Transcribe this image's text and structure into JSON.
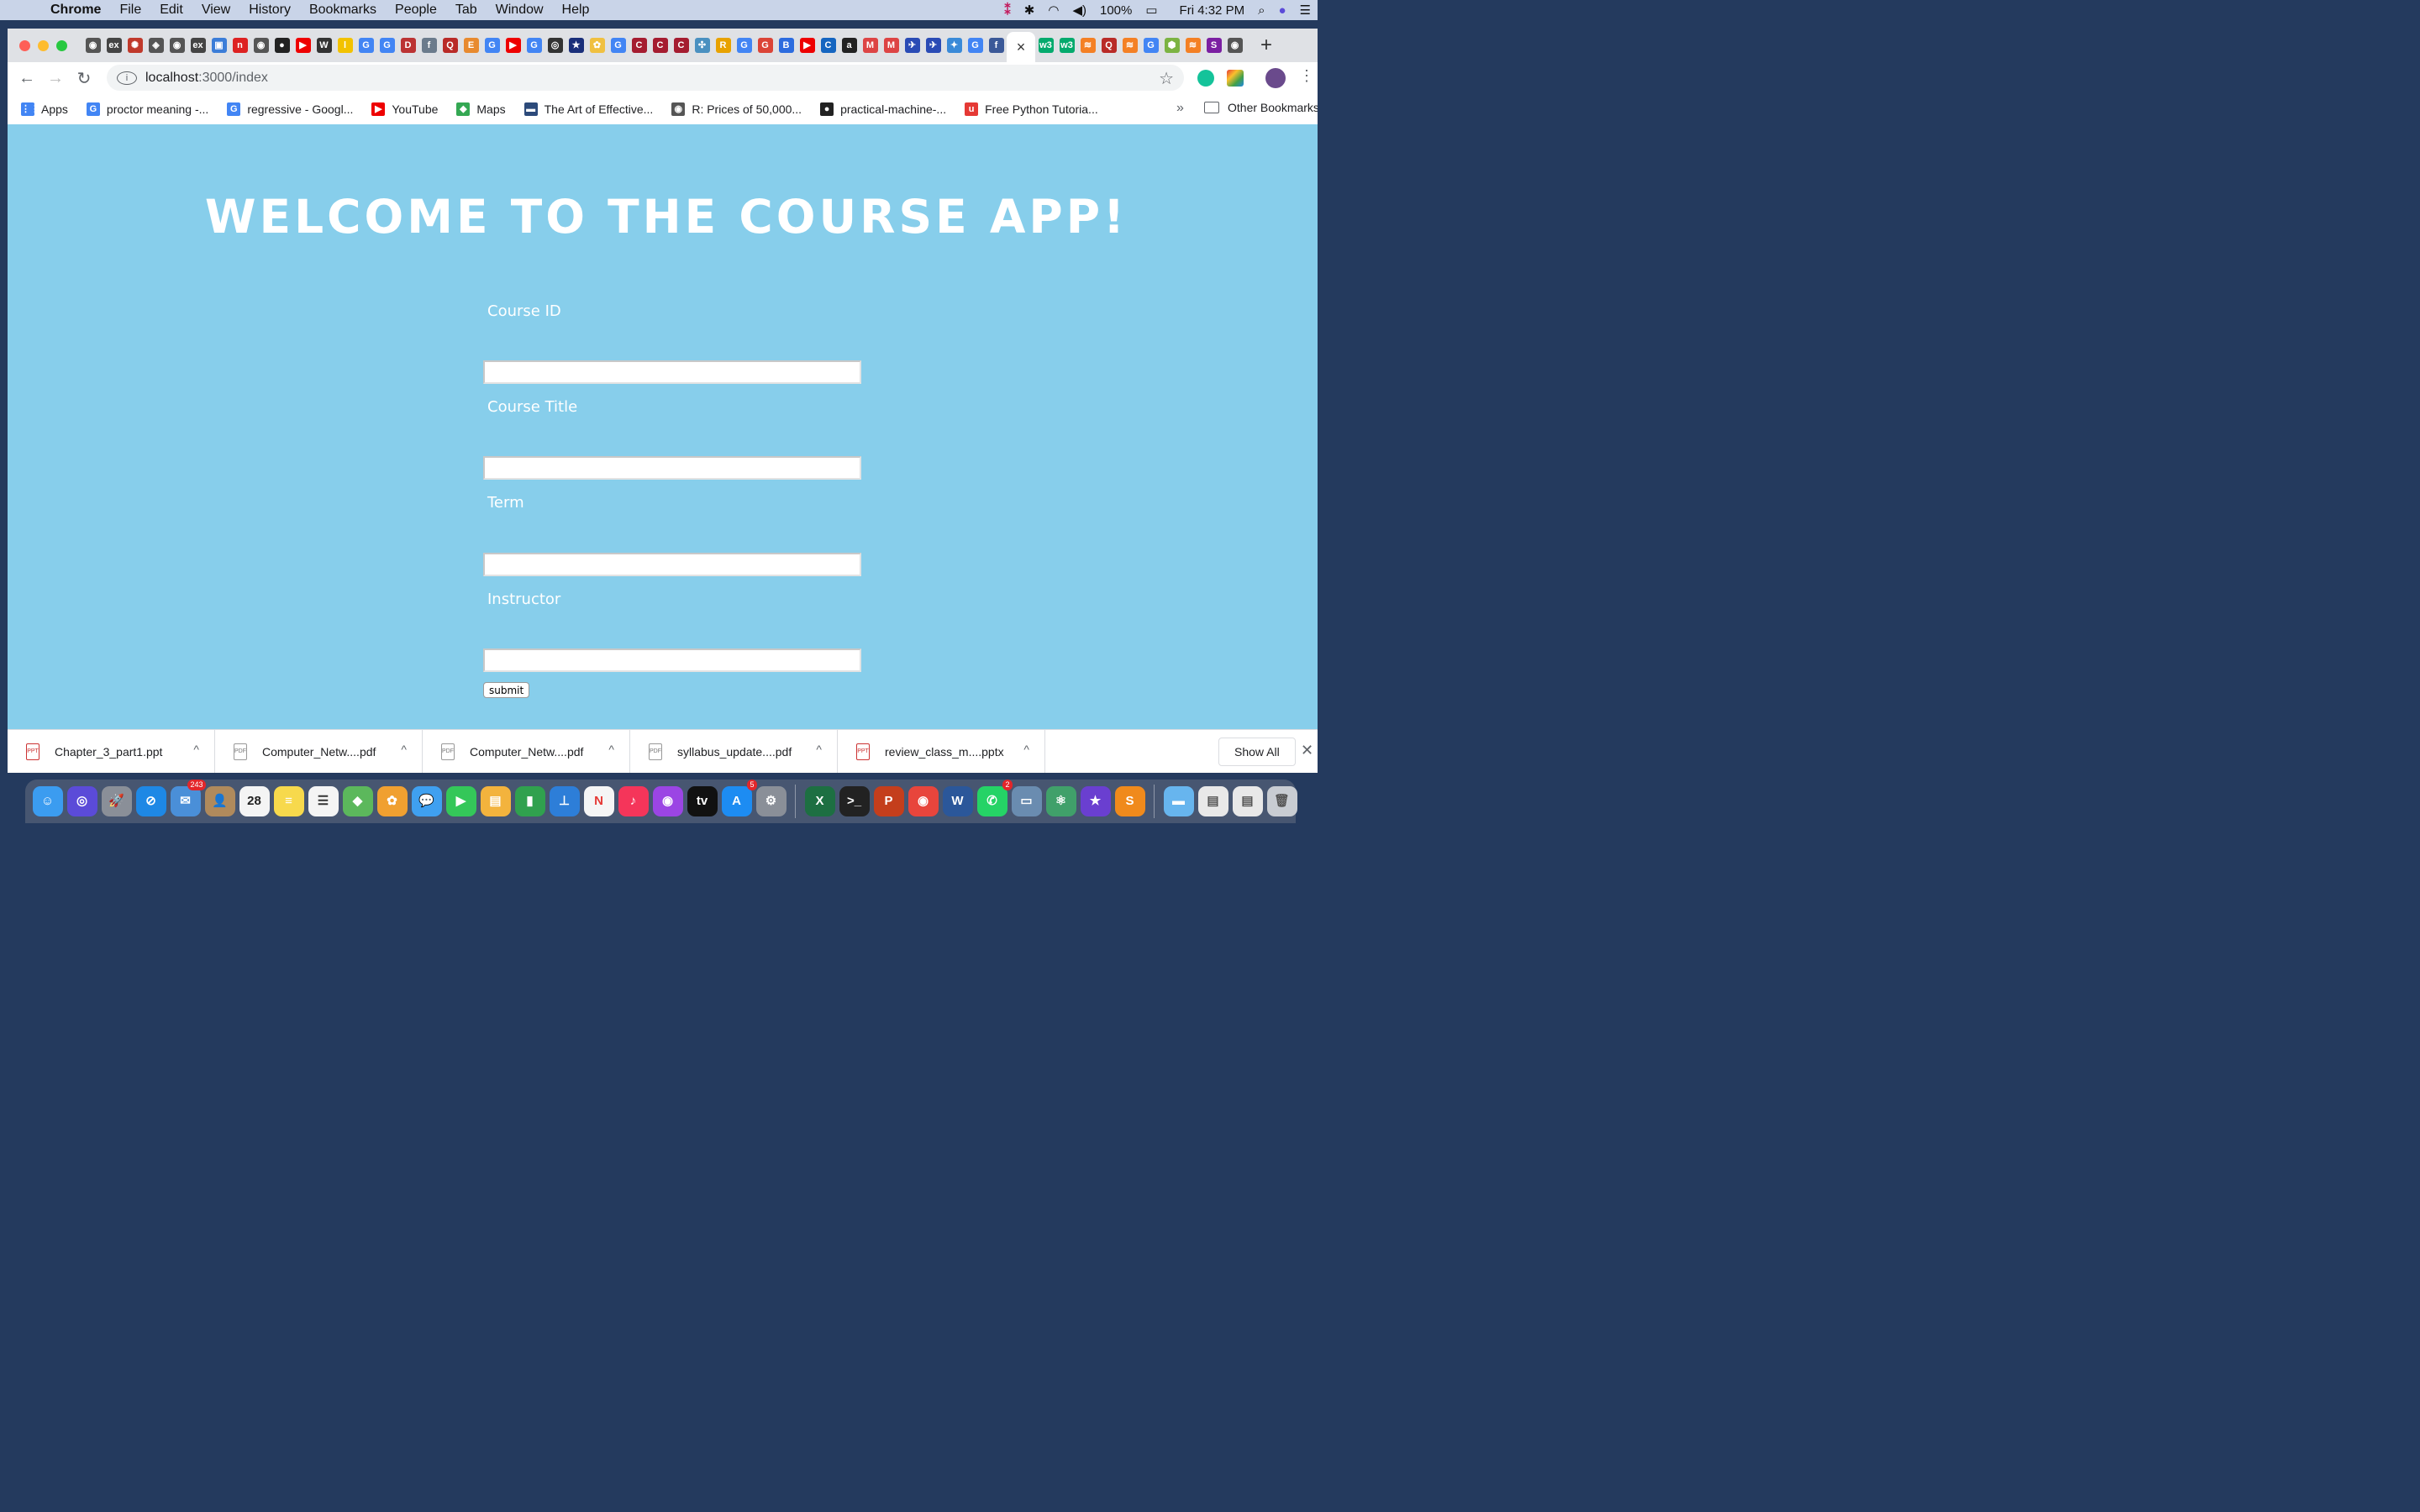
{
  "menubar": {
    "apple": "",
    "items": [
      "Chrome",
      "File",
      "Edit",
      "View",
      "History",
      "Bookmarks",
      "People",
      "Tab",
      "Window",
      "Help"
    ],
    "battery": "100%",
    "clock": "Fri 4:32 PM"
  },
  "tabs": {
    "favicons": [
      {
        "glyph": "◉",
        "color": "#555"
      },
      {
        "glyph": "ex",
        "color": "#444"
      },
      {
        "glyph": "✺",
        "color": "#c0392b"
      },
      {
        "glyph": "◈",
        "color": "#555"
      },
      {
        "glyph": "◉",
        "color": "#555"
      },
      {
        "glyph": "ex",
        "color": "#444"
      },
      {
        "glyph": "▣",
        "color": "#3b7dd8"
      },
      {
        "glyph": "n",
        "color": "#d22"
      },
      {
        "glyph": "◉",
        "color": "#555"
      },
      {
        "glyph": "●",
        "color": "#222"
      },
      {
        "glyph": "▶",
        "color": "#e00"
      },
      {
        "glyph": "W",
        "color": "#333"
      },
      {
        "glyph": "l",
        "color": "#f2c200"
      },
      {
        "glyph": "G",
        "color": "#4285f4"
      },
      {
        "glyph": "G",
        "color": "#4285f4"
      },
      {
        "glyph": "D",
        "color": "#b33"
      },
      {
        "glyph": "f",
        "color": "#6b7b8c"
      },
      {
        "glyph": "Q",
        "color": "#b92b27"
      },
      {
        "glyph": "E",
        "color": "#e88a2f"
      },
      {
        "glyph": "G",
        "color": "#4285f4"
      },
      {
        "glyph": "▶",
        "color": "#e00"
      },
      {
        "glyph": "G",
        "color": "#4285f4"
      },
      {
        "glyph": "◎",
        "color": "#333"
      },
      {
        "glyph": "★",
        "color": "#1a2f7a"
      },
      {
        "glyph": "✿",
        "color": "#f0c040"
      },
      {
        "glyph": "G",
        "color": "#4285f4"
      },
      {
        "glyph": "C",
        "color": "#a51c30"
      },
      {
        "glyph": "C",
        "color": "#a51c30"
      },
      {
        "glyph": "C",
        "color": "#a51c30"
      },
      {
        "glyph": "✣",
        "color": "#4a90c0"
      },
      {
        "glyph": "R",
        "color": "#e8a200"
      },
      {
        "glyph": "G",
        "color": "#4285f4"
      },
      {
        "glyph": "G",
        "color": "#db4437"
      },
      {
        "glyph": "B",
        "color": "#2d6cdf"
      },
      {
        "glyph": "▶",
        "color": "#e00"
      },
      {
        "glyph": "C",
        "color": "#1565c0"
      },
      {
        "glyph": "a",
        "color": "#222"
      },
      {
        "glyph": "M",
        "color": "#d44"
      },
      {
        "glyph": "M",
        "color": "#d44"
      },
      {
        "glyph": "✈",
        "color": "#2a4bb5"
      },
      {
        "glyph": "✈",
        "color": "#2a4bb5"
      },
      {
        "glyph": "✦",
        "color": "#3a8ad8"
      },
      {
        "glyph": "G",
        "color": "#4285f4"
      },
      {
        "glyph": "f",
        "color": "#3b5998"
      }
    ],
    "active_close": "×",
    "favicons_after": [
      {
        "glyph": "w3",
        "color": "#04aa6d"
      },
      {
        "glyph": "w3",
        "color": "#04aa6d"
      },
      {
        "glyph": "≋",
        "color": "#f48024"
      },
      {
        "glyph": "Q",
        "color": "#b92b27"
      },
      {
        "glyph": "≋",
        "color": "#f48024"
      },
      {
        "glyph": "G",
        "color": "#4285f4"
      },
      {
        "glyph": "⬢",
        "color": "#7cb342"
      },
      {
        "glyph": "≋",
        "color": "#f48024"
      },
      {
        "glyph": "S",
        "color": "#7b1fa2"
      },
      {
        "glyph": "◉",
        "color": "#555"
      }
    ],
    "new_tab": "+"
  },
  "toolbar": {
    "back": "←",
    "forward": "→",
    "reload": "↻",
    "url_host": "localhost",
    "url_path": ":3000/index",
    "star": "☆",
    "menu": "⋮"
  },
  "bookmarks": {
    "items": [
      {
        "label": "Apps",
        "icon": "⋮⋮",
        "color": "#4285f4"
      },
      {
        "label": "proctor meaning -...",
        "icon": "G",
        "color": "#4285f4"
      },
      {
        "label": "regressive - Googl...",
        "icon": "G",
        "color": "#4285f4"
      },
      {
        "label": "YouTube",
        "icon": "▶",
        "color": "#e00"
      },
      {
        "label": "Maps",
        "icon": "◆",
        "color": "#34a853"
      },
      {
        "label": "The Art of Effective...",
        "icon": "▬",
        "color": "#2c4a7a"
      },
      {
        "label": "R: Prices of 50,000...",
        "icon": "◉",
        "color": "#555"
      },
      {
        "label": "practical-machine-...",
        "icon": "●",
        "color": "#222"
      },
      {
        "label": "Free Python Tutoria...",
        "icon": "u",
        "color": "#e53935"
      }
    ],
    "more": "»",
    "other": "Other Bookmarks"
  },
  "page": {
    "title": "WELCOME TO THE COURSE APP!",
    "background": "#87ceeb",
    "fields": [
      {
        "label": "Course ID",
        "value": ""
      },
      {
        "label": "Course Title",
        "value": ""
      },
      {
        "label": "Term",
        "value": ""
      },
      {
        "label": "Instructor",
        "value": ""
      }
    ],
    "submit_label": "submit"
  },
  "downloads": {
    "items": [
      {
        "name": "Chapter_3_part1.ppt",
        "type": "ppt"
      },
      {
        "name": "Computer_Netw....pdf",
        "type": "pdf"
      },
      {
        "name": "Computer_Netw....pdf",
        "type": "pdf"
      },
      {
        "name": "syllabus_update....pdf",
        "type": "pdf"
      },
      {
        "name": "review_class_m....pptx",
        "type": "ppt"
      }
    ],
    "chevron": "^",
    "show_all": "Show All",
    "close": "✕"
  },
  "dock": {
    "apps": [
      {
        "name": "finder-icon",
        "glyph": "☺",
        "color": "#3b9cf0"
      },
      {
        "name": "siri-icon",
        "glyph": "◎",
        "color": "#5b4bd8"
      },
      {
        "name": "launchpad-icon",
        "glyph": "🚀",
        "color": "#8a8f98"
      },
      {
        "name": "safari-icon",
        "glyph": "⊘",
        "color": "#1e88e5"
      },
      {
        "name": "mail-icon",
        "glyph": "✉",
        "color": "#4a8fd8",
        "badge": "243"
      },
      {
        "name": "contacts-icon",
        "glyph": "👤",
        "color": "#b08a5c"
      },
      {
        "name": "calendar-icon",
        "glyph": "28",
        "color": "#f4f4f4",
        "fg": "#222"
      },
      {
        "name": "notes-icon",
        "glyph": "≡",
        "color": "#f7d94c"
      },
      {
        "name": "reminders-icon",
        "glyph": "☰",
        "color": "#f4f4f4",
        "fg": "#333"
      },
      {
        "name": "maps-icon",
        "glyph": "◆",
        "color": "#5cb85c"
      },
      {
        "name": "photos-icon",
        "glyph": "✿",
        "color": "#f0a030"
      },
      {
        "name": "messages-icon",
        "glyph": "💬",
        "color": "#3fa0f0"
      },
      {
        "name": "facetime-icon",
        "glyph": "▶",
        "color": "#34c759"
      },
      {
        "name": "keynote-icon",
        "glyph": "▤",
        "color": "#f3b33d"
      },
      {
        "name": "numbers-icon",
        "glyph": "▮",
        "color": "#30a14e"
      },
      {
        "name": "keynote-icon-2",
        "glyph": "⊥",
        "color": "#2d7ed8"
      },
      {
        "name": "news-icon",
        "glyph": "N",
        "color": "#f5f5f5",
        "fg": "#e53935"
      },
      {
        "name": "music-icon",
        "glyph": "♪",
        "color": "#f5355a"
      },
      {
        "name": "podcasts-icon",
        "glyph": "◉",
        "color": "#9b45e4"
      },
      {
        "name": "tv-icon",
        "glyph": "tv",
        "color": "#111"
      },
      {
        "name": "app-store-icon",
        "glyph": "A",
        "color": "#1d8cf2",
        "badge": "5"
      },
      {
        "name": "system-preferences-icon",
        "glyph": "⚙",
        "color": "#8a8f98"
      },
      {
        "name": "sep",
        "glyph": "",
        "color": ""
      },
      {
        "name": "excel-icon",
        "glyph": "X",
        "color": "#1d6f42"
      },
      {
        "name": "terminal-icon",
        "glyph": ">_",
        "color": "#222"
      },
      {
        "name": "powerpoint-icon",
        "glyph": "P",
        "color": "#c43e1c"
      },
      {
        "name": "chrome-icon",
        "glyph": "◉",
        "color": "#e8453c"
      },
      {
        "name": "word-icon",
        "glyph": "W",
        "color": "#2b579a"
      },
      {
        "name": "whatsapp-icon",
        "glyph": "✆",
        "color": "#25d366",
        "badge": "2"
      },
      {
        "name": "preview-icon",
        "glyph": "▭",
        "color": "#6a8cb0"
      },
      {
        "name": "atom-icon",
        "glyph": "⚛",
        "color": "#40a06a"
      },
      {
        "name": "imovie-icon",
        "glyph": "★",
        "color": "#6a3fd0"
      },
      {
        "name": "sublime-icon",
        "glyph": "S",
        "color": "#f08a1c"
      },
      {
        "name": "sep",
        "glyph": "",
        "color": ""
      },
      {
        "name": "folder-icon",
        "glyph": "▬",
        "color": "#67b5ee"
      },
      {
        "name": "documents-icon",
        "glyph": "▤",
        "color": "#e8e8e8",
        "fg": "#555"
      },
      {
        "name": "downloads-icon",
        "glyph": "▤",
        "color": "#e8e8e8",
        "fg": "#555"
      },
      {
        "name": "trash-icon",
        "glyph": "🗑",
        "color": "#c8ccd2",
        "fg": "#555"
      }
    ]
  }
}
